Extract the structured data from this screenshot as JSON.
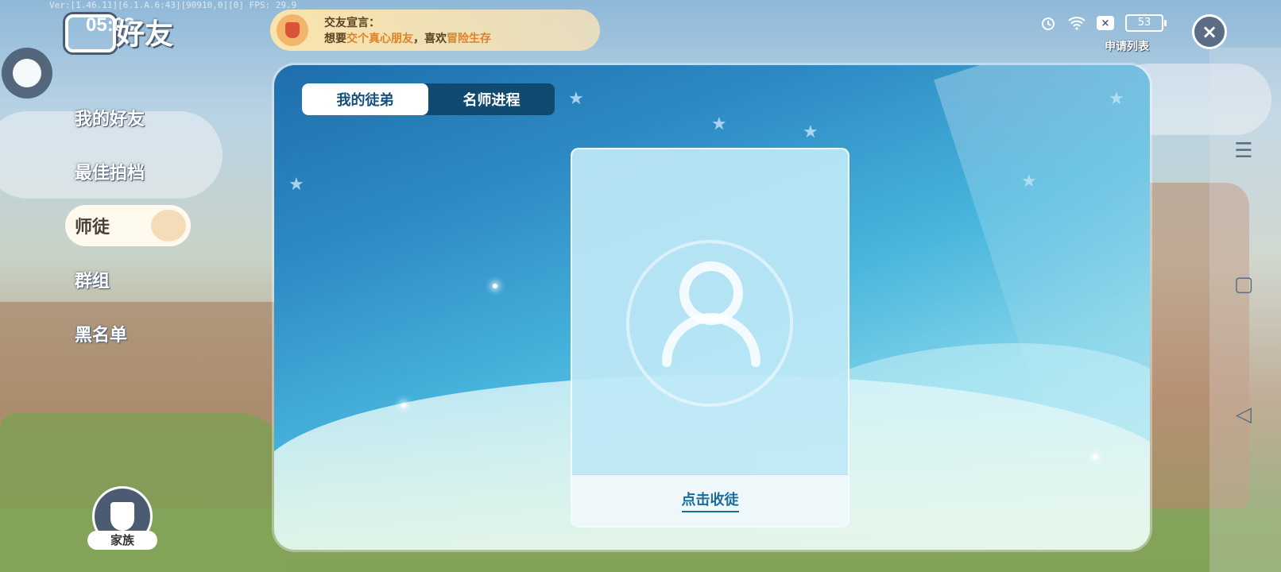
{
  "debug_text": "Ver:[1.46.11][6.1.A.6:43][90910,0][0] FPS: 29.9",
  "clock": "05:03",
  "screen_title": "好友",
  "notice": {
    "title": "交友宣言：",
    "prefix": "想要",
    "highlight1": "交个真心朋友",
    "middle": "，喜欢",
    "highlight2": "冒险生存"
  },
  "status": {
    "alarm_icon": "alarm-icon",
    "wifi_icon": "wifi-icon",
    "x_box": "×",
    "battery": "53"
  },
  "apply_list_label": "申请列表",
  "close_label": "×",
  "sidebar": {
    "items": [
      {
        "label": "我的好友"
      },
      {
        "label": "最佳拍档"
      },
      {
        "label": "师徒"
      },
      {
        "label": "群组"
      },
      {
        "label": "黑名单"
      }
    ],
    "active_index": 2
  },
  "family_label": "家族",
  "tabs": [
    {
      "label": "我的徒弟"
    },
    {
      "label": "名师进程"
    }
  ],
  "card": {
    "action_label": "点击收徒"
  },
  "colors": {
    "accent_dark": "#114a70",
    "link": "#1b6b9b",
    "notice_highlight": "#e08227"
  }
}
